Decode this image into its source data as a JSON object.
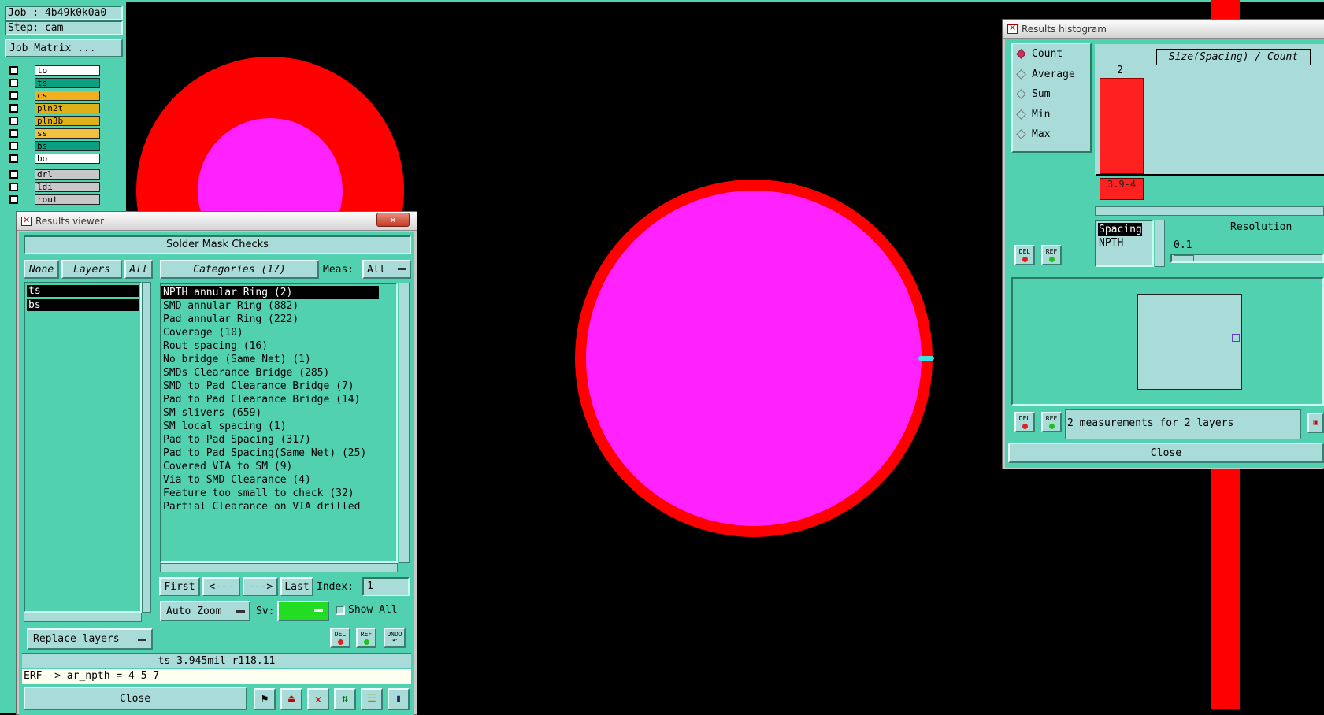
{
  "job_panel": {
    "job": "Job : 4b49k0k0a0",
    "step": "Step: cam",
    "matrix_button": "Job Matrix ..."
  },
  "layers": [
    {
      "name": "to",
      "color": "#ffffff"
    },
    {
      "name": "ts",
      "color": "#0aa080"
    },
    {
      "name": "cs",
      "color": "#f0b020"
    },
    {
      "name": "pln2t",
      "color": "#e0b018"
    },
    {
      "name": "pln3b",
      "color": "#e0b018"
    },
    {
      "name": "ss",
      "color": "#f0c040"
    },
    {
      "name": "bs",
      "color": "#0aa080"
    },
    {
      "name": "bo",
      "color": "#ffffff"
    },
    {
      "name": "drl",
      "color": "#c8c8c8"
    },
    {
      "name": "ldi",
      "color": "#c8c8c8"
    },
    {
      "name": "rout",
      "color": "#c8c8c8"
    }
  ],
  "results_viewer": {
    "window_title": "Results viewer",
    "header": "Solder Mask Checks",
    "none_btn": "None",
    "layers_btn": "Layers",
    "all_btn": "All",
    "layer_list": [
      "ts",
      "bs"
    ],
    "categories_btn": "Categories (17)",
    "meas_label": "Meas:",
    "meas_value": "All",
    "categories": [
      "NPTH annular Ring (2)",
      "SMD annular Ring (882)",
      "Pad annular Ring (222)",
      "Coverage (10)",
      "Rout spacing (16)",
      "No bridge (Same Net) (1)",
      "SMDs Clearance Bridge (285)",
      "SMD to Pad Clearance Bridge (7)",
      "Pad to Pad Clearance Bridge (14)",
      "SM slivers (659)",
      "SM local spacing (1)",
      "Pad to Pad Spacing (317)",
      "Pad to Pad Spacing(Same Net) (25)",
      "Covered VIA to SM (9)",
      "Via to SMD Clearance (4)",
      "Feature too small to check (32)",
      "Partial Clearance on VIA drilled"
    ],
    "nav": {
      "first": "First",
      "prev": "<---",
      "next": "--->",
      "last": "Last",
      "index_label": "Index:",
      "index_value": "1"
    },
    "auto_zoom": "Auto Zoom",
    "sv_label": "Sv:",
    "show_all": "Show All",
    "replace_layers": "Replace layers",
    "del": "DEL",
    "ref": "REF",
    "undo": "UNDO",
    "status": "ts 3.945mil   r118.11",
    "erf": "ERF--> ar_npth = 4 5 7",
    "close": "Close"
  },
  "histogram": {
    "window_title": "Results histogram",
    "modes": [
      "Count",
      "Average",
      "Sum",
      "Min",
      "Max"
    ],
    "selected_mode": "Count",
    "chart_title": "Size(Spacing) / Count",
    "bar_value": "2",
    "bar_label": "3.9-4",
    "attr_list": [
      "Spacing",
      "NPTH"
    ],
    "resolution_label": "Resolution",
    "resolution_value": "0.1",
    "measurements": "2 measurements for 2 layers",
    "close": "Close",
    "del": "DEL",
    "ref": "REF"
  },
  "colors": {
    "panel": "#52d1b0",
    "light_panel": "#a9dcd8",
    "pad_outer": "#ff0000",
    "pad_inner": "#ff22ff"
  }
}
